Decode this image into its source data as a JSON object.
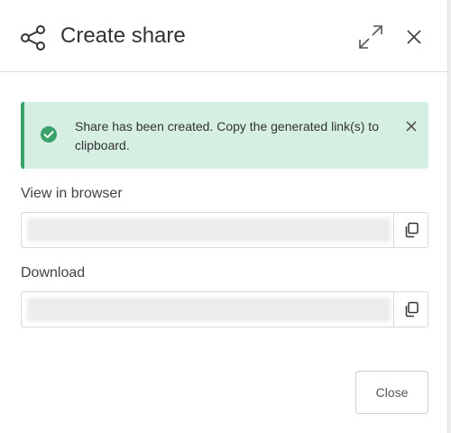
{
  "dialog": {
    "title": "Create share",
    "icons": {
      "share": "share-icon",
      "expand": "expand-icon",
      "close": "close-icon"
    }
  },
  "alert": {
    "message": "Share has been created. Copy the generated link(s) to clipboard.",
    "status": "success",
    "color": "#3aa36a",
    "background": "#d5efe2",
    "icons": {
      "status": "check-circle-icon",
      "dismiss": "close-icon"
    }
  },
  "fields": [
    {
      "label": "View in browser",
      "value": "",
      "copy_icon": "copy-icon"
    },
    {
      "label": "Download",
      "value": "",
      "copy_icon": "copy-icon"
    }
  ],
  "footer": {
    "close_label": "Close"
  }
}
